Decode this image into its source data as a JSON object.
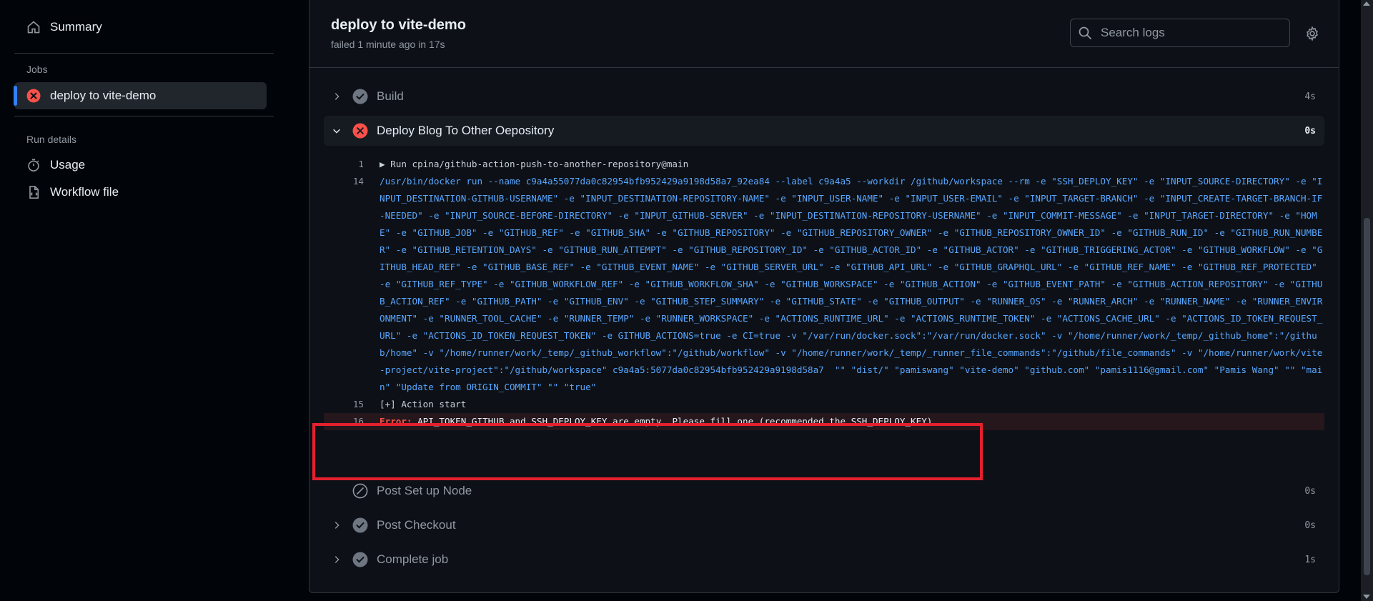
{
  "sidebar": {
    "summary_label": "Summary",
    "jobs_heading": "Jobs",
    "job_label": "deploy to vite-demo",
    "run_details_heading": "Run details",
    "usage_label": "Usage",
    "workflow_file_label": "Workflow file"
  },
  "header": {
    "title": "deploy to vite-demo",
    "subtitle": "failed 1 minute ago in 17s",
    "search_placeholder": "Search logs"
  },
  "steps": [
    {
      "name": "Build",
      "duration": "4s",
      "status": "success"
    },
    {
      "name": "Deploy Blog To Other Oepository",
      "duration": "0s",
      "status": "failure"
    },
    {
      "name": "Post Set up Node",
      "duration": "0s",
      "status": "skipped"
    },
    {
      "name": "Post Checkout",
      "duration": "0s",
      "status": "success"
    },
    {
      "name": "Complete job",
      "duration": "1s",
      "status": "success"
    }
  ],
  "log": {
    "line1_num": "1",
    "line1_text": "▶ Run cpina/github-action-push-to-another-repository@main",
    "line14_num": "14",
    "line14_text": "/usr/bin/docker run --name c9a4a55077da0c82954bfb952429a9198d58a7_92ea84 --label c9a4a5 --workdir /github/workspace --rm -e \"SSH_DEPLOY_KEY\" -e \"INPUT_SOURCE-DIRECTORY\" -e \"INPUT_DESTINATION-GITHUB-USERNAME\" -e \"INPUT_DESTINATION-REPOSITORY-NAME\" -e \"INPUT_USER-NAME\" -e \"INPUT_USER-EMAIL\" -e \"INPUT_TARGET-BRANCH\" -e \"INPUT_CREATE-TARGET-BRANCH-IF-NEEDED\" -e \"INPUT_SOURCE-BEFORE-DIRECTORY\" -e \"INPUT_GITHUB-SERVER\" -e \"INPUT_DESTINATION-REPOSITORY-USERNAME\" -e \"INPUT_COMMIT-MESSAGE\" -e \"INPUT_TARGET-DIRECTORY\" -e \"HOME\" -e \"GITHUB_JOB\" -e \"GITHUB_REF\" -e \"GITHUB_SHA\" -e \"GITHUB_REPOSITORY\" -e \"GITHUB_REPOSITORY_OWNER\" -e \"GITHUB_REPOSITORY_OWNER_ID\" -e \"GITHUB_RUN_ID\" -e \"GITHUB_RUN_NUMBER\" -e \"GITHUB_RETENTION_DAYS\" -e \"GITHUB_RUN_ATTEMPT\" -e \"GITHUB_REPOSITORY_ID\" -e \"GITHUB_ACTOR_ID\" -e \"GITHUB_ACTOR\" -e \"GITHUB_TRIGGERING_ACTOR\" -e \"GITHUB_WORKFLOW\" -e \"GITHUB_HEAD_REF\" -e \"GITHUB_BASE_REF\" -e \"GITHUB_EVENT_NAME\" -e \"GITHUB_SERVER_URL\" -e \"GITHUB_API_URL\" -e \"GITHUB_GRAPHQL_URL\" -e \"GITHUB_REF_NAME\" -e \"GITHUB_REF_PROTECTED\" -e \"GITHUB_REF_TYPE\" -e \"GITHUB_WORKFLOW_REF\" -e \"GITHUB_WORKFLOW_SHA\" -e \"GITHUB_WORKSPACE\" -e \"GITHUB_ACTION\" -e \"GITHUB_EVENT_PATH\" -e \"GITHUB_ACTION_REPOSITORY\" -e \"GITHUB_ACTION_REF\" -e \"GITHUB_PATH\" -e \"GITHUB_ENV\" -e \"GITHUB_STEP_SUMMARY\" -e \"GITHUB_STATE\" -e \"GITHUB_OUTPUT\" -e \"RUNNER_OS\" -e \"RUNNER_ARCH\" -e \"RUNNER_NAME\" -e \"RUNNER_ENVIRONMENT\" -e \"RUNNER_TOOL_CACHE\" -e \"RUNNER_TEMP\" -e \"RUNNER_WORKSPACE\" -e \"ACTIONS_RUNTIME_URL\" -e \"ACTIONS_RUNTIME_TOKEN\" -e \"ACTIONS_CACHE_URL\" -e \"ACTIONS_ID_TOKEN_REQUEST_URL\" -e \"ACTIONS_ID_TOKEN_REQUEST_TOKEN\" -e GITHUB_ACTIONS=true -e CI=true -v \"/var/run/docker.sock\":\"/var/run/docker.sock\" -v \"/home/runner/work/_temp/_github_home\":\"/github/home\" -v \"/home/runner/work/_temp/_github_workflow\":\"/github/workflow\" -v \"/home/runner/work/_temp/_runner_file_commands\":\"/github/file_commands\" -v \"/home/runner/work/vite-project/vite-project\":\"/github/workspace\" c9a4a5:5077da0c82954bfb952429a9198d58a7  \"\" \"dist/\" \"pamiswang\" \"vite-demo\" \"github.com\" \"pamis1116@gmail.com\" \"Pamis Wang\" \"\" \"main\" \"Update from ORIGIN_COMMIT\" \"\" \"true\"",
    "line15_num": "15",
    "line15_text": "[+] Action start",
    "line16_num": "16",
    "line16_error_label": "Error:",
    "line16_text": " API_TOKEN_GITHUB and SSH_DEPLOY_KEY are empty. Please fill one (recommended the SSH_DEPLOY_KEY)"
  },
  "colors": {
    "background": "#010409",
    "panel": "#0d1117",
    "accent": "#2f81f7",
    "error": "#f85149",
    "success_icon": "#9198a1",
    "highlight_border": "#e5202e"
  }
}
